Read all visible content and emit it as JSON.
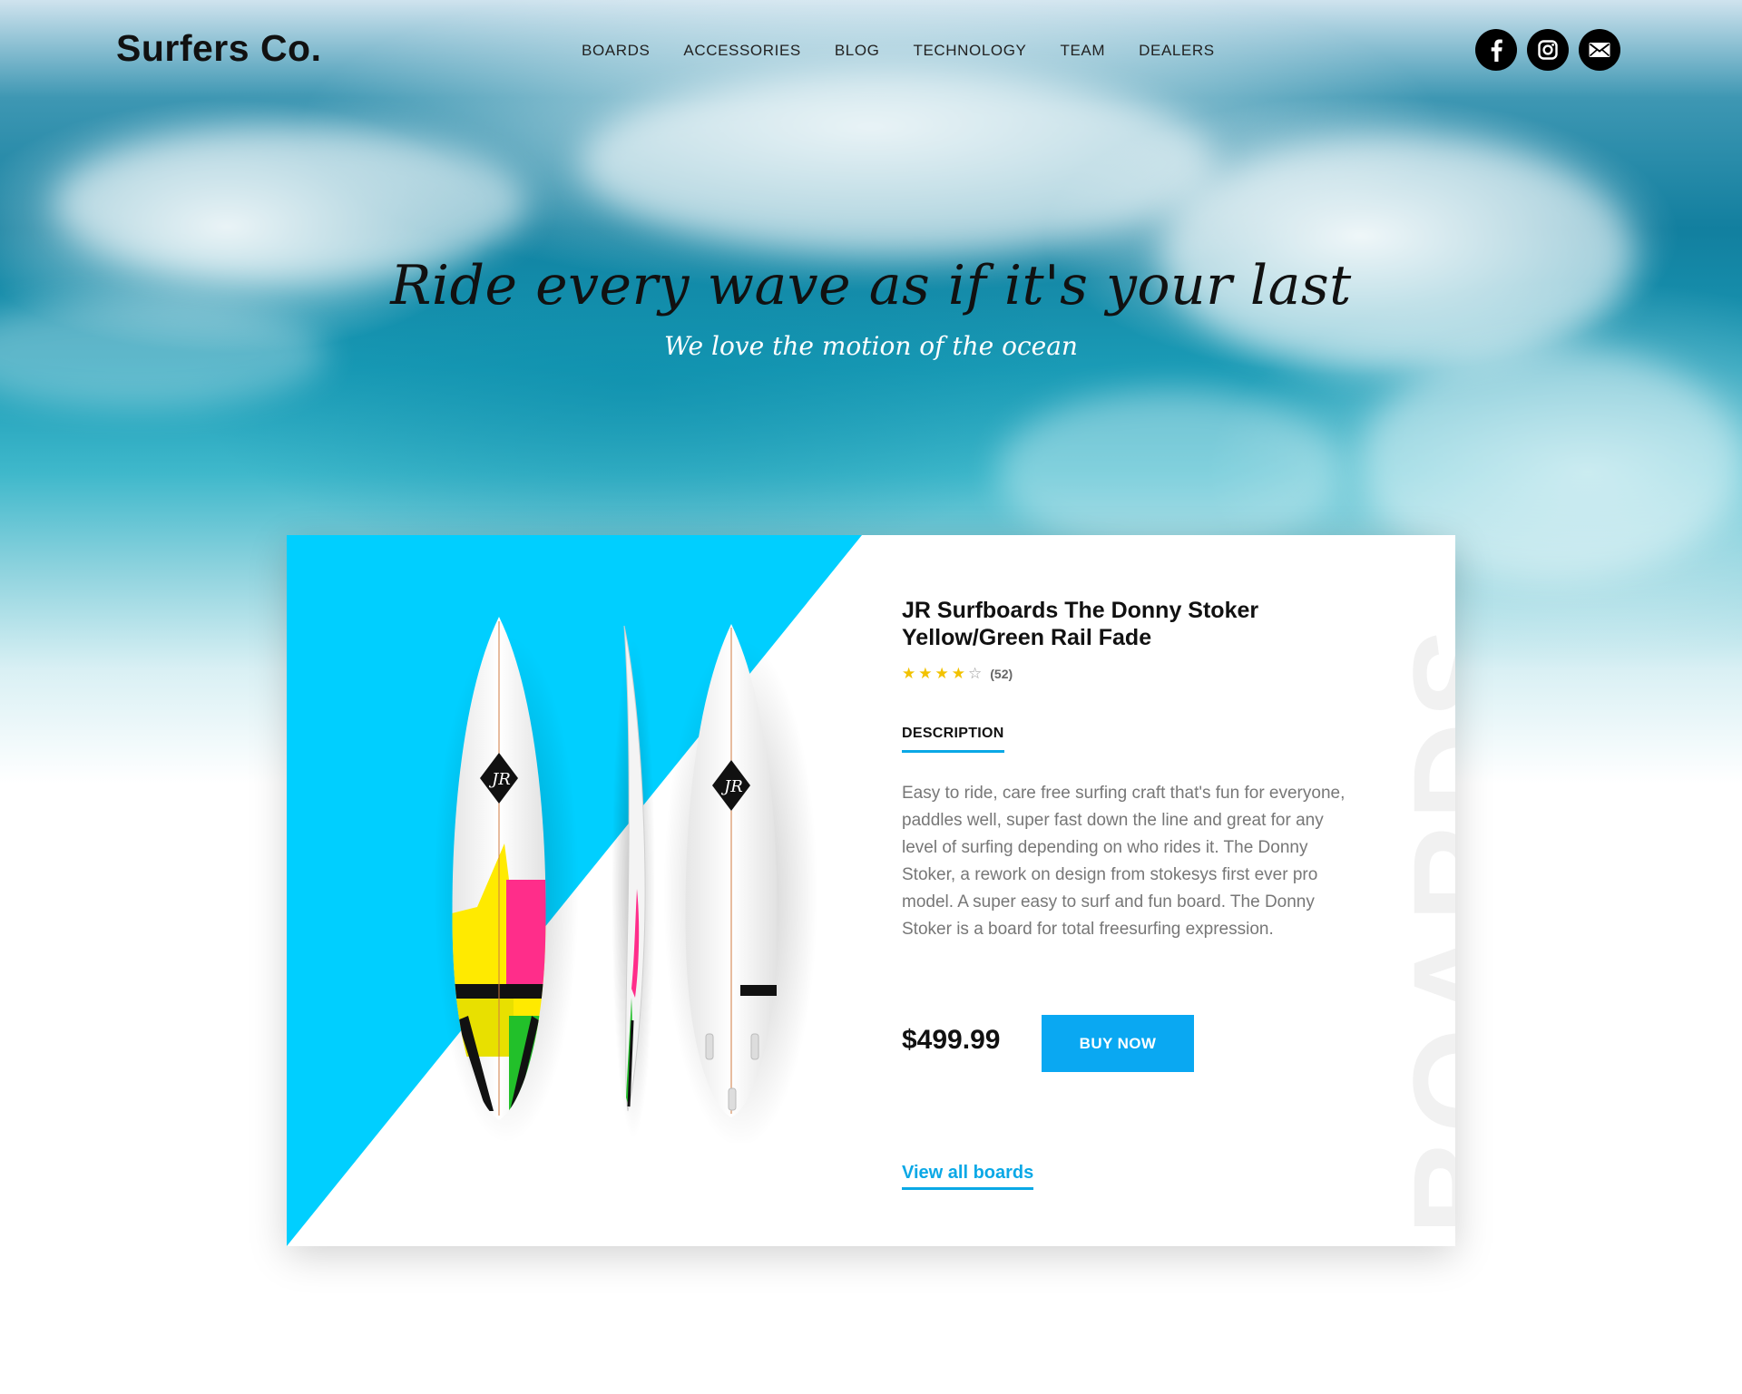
{
  "brand": {
    "name": "Surfers Co."
  },
  "nav": {
    "items": [
      {
        "label": "BOARDS"
      },
      {
        "label": "ACCESSORIES"
      },
      {
        "label": "BLOG"
      },
      {
        "label": "TECHNOLOGY"
      },
      {
        "label": "TEAM"
      },
      {
        "label": "DEALERS"
      }
    ]
  },
  "social": {
    "icons": [
      "facebook-icon",
      "instagram-icon",
      "mail-icon"
    ],
    "glyphs": [
      "f",
      "◎",
      "✉"
    ]
  },
  "hero": {
    "headline": "Ride every wave as if it's your last",
    "subline": "We love the motion of the ocean"
  },
  "product": {
    "title": "JR Surfboards The Donny Stoker Yellow/Green Rail Fade",
    "rating": 4,
    "rating_max": 5,
    "review_count": "(52)",
    "tab": "DESCRIPTION",
    "description": "Easy to ride, care free surfing craft that's fun for everyone, paddles well, super fast down the line and great for any level of surfing depending on who rides it. The Donny Stoker, a rework on design from stokesys first ever pro model. A super easy to surf and fun board. The Donny Stoker is a board for total freesurfing expression.",
    "price": "$499.99",
    "buy_label": "BUY NOW",
    "view_all_label": "View all boards",
    "watermark": "BOARDS"
  },
  "colors": {
    "accent": "#0aa8f2",
    "card_panel": "#00cfff",
    "star": "#f2c200"
  }
}
